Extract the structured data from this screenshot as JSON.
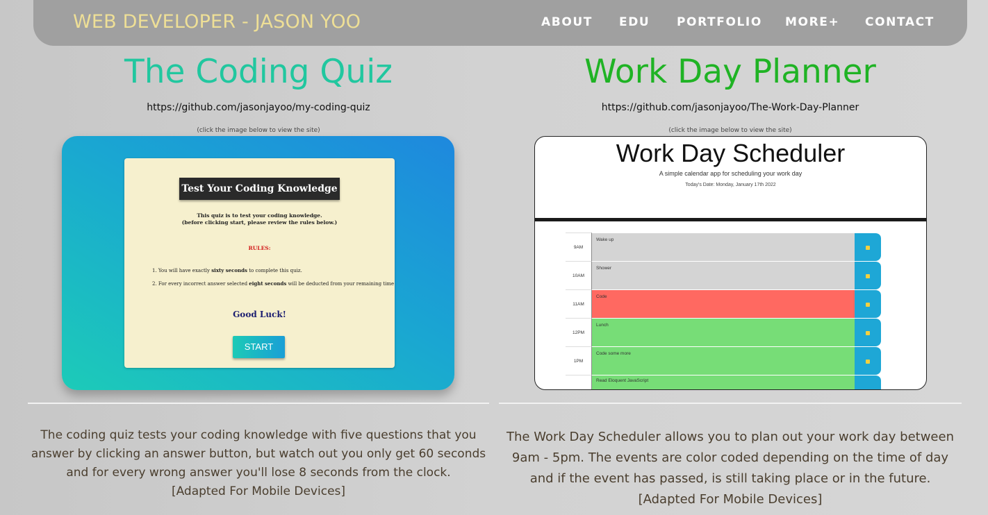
{
  "nav": {
    "brand": "WEB DEVELOPER - JASON YOO",
    "links": [
      "ABOUT",
      "EDU",
      "PORTFOLIO",
      "MORE+",
      "CONTACT"
    ]
  },
  "projects": [
    {
      "title": "The Coding Quiz",
      "title_color": "#21c79f",
      "repo": "https://github.com/jasonjayoo/my-coding-quiz",
      "hint": "(click the image below to view the site)",
      "description": "The coding quiz tests your coding knowledge with five questions that you answer by clicking an answer button, but watch out you only get 60 seconds and for every wrong answer you'll lose 8 seconds from the clock.",
      "mobile_note": "[Adapted For Mobile Devices]",
      "preview": {
        "heading": "Test Your Coding Knowledge",
        "intro_line1": "This quiz is to test your coding knowledge.",
        "intro_line2": "(before clicking start, please review the rules below.)",
        "rules_label": "RULES:",
        "rule1_pre": "1. You will have exactly ",
        "rule1_bold": "sixty seconds",
        "rule1_post": " to complete this quiz.",
        "rule2_pre": "2. For every incorrect answer selected ",
        "rule2_bold": "eight seconds",
        "rule2_post": " will be deducted from your remaining time",
        "luck": "Good Luck!",
        "start": "START"
      }
    },
    {
      "title": "Work Day Planner",
      "title_color": "#1fb324",
      "repo": "https://github.com/jasonjayoo/The-Work-Day-Planner",
      "hint": "(click the image below to view the site)",
      "description": "The Work Day Scheduler allows you to plan out your work day between 9am - 5pm. The events are color coded depending on the time of day and if the event has passed, is still taking place or in the future.",
      "mobile_note": "[Adapted For Mobile Devices]",
      "preview": {
        "title": "Work Day Scheduler",
        "subtitle": "A simple calendar app for scheduling your work day",
        "date": "Today's Date: Monday, January 17th 2022",
        "rows": [
          {
            "hour": "9AM",
            "text": "Wake up",
            "color": "#d4d4d4"
          },
          {
            "hour": "10AM",
            "text": "Shower",
            "color": "#d4d4d4"
          },
          {
            "hour": "11AM",
            "text": "Code",
            "color": "#ff6961"
          },
          {
            "hour": "12PM",
            "text": "Lunch",
            "color": "#77dd77"
          },
          {
            "hour": "1PM",
            "text": "Code some more",
            "color": "#77dd77"
          },
          {
            "hour": "",
            "text": "Read Eloquent JavaScript",
            "color": "#77dd77"
          }
        ]
      }
    }
  ]
}
